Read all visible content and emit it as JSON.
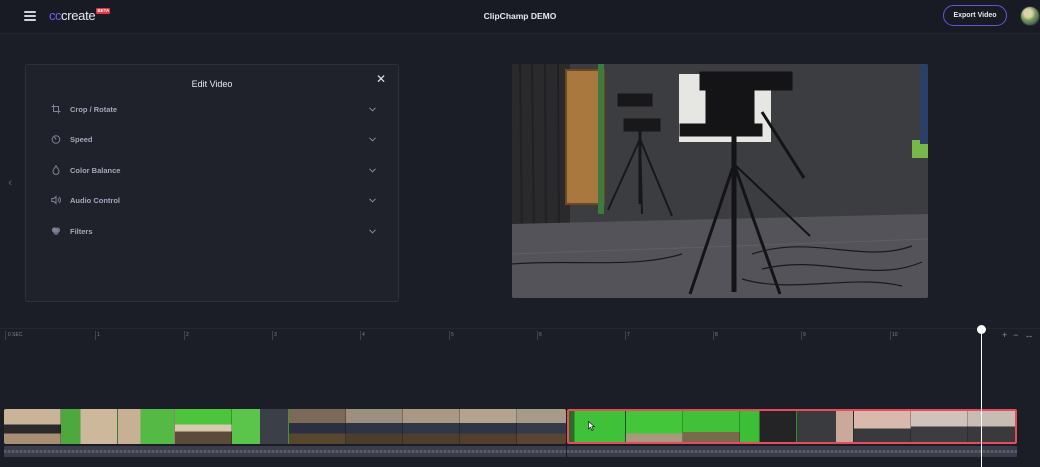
{
  "header": {
    "menu_icon": "hamburger-icon",
    "logo_prefix": "cc",
    "logo_word": "create",
    "logo_badge": "BETA",
    "title": "ClipChamp DEMO",
    "export_label": "Export Video"
  },
  "edit_panel": {
    "title": "Edit Video",
    "close_icon": "close-icon",
    "items": [
      {
        "label": "Crop / Rotate",
        "icon": "crop-icon"
      },
      {
        "label": "Speed",
        "icon": "speed-icon"
      },
      {
        "label": "Color Balance",
        "icon": "droplet-icon"
      },
      {
        "label": "Audio Control",
        "icon": "volume-icon"
      },
      {
        "label": "Filters",
        "icon": "filters-icon"
      }
    ]
  },
  "timeline": {
    "ticks": [
      "0 SEC",
      "1",
      "2",
      "3",
      "4",
      "5",
      "6",
      "7",
      "8",
      "9",
      "10"
    ],
    "zoom_in": "+",
    "zoom_out": "−",
    "expand": "↔"
  },
  "colors": {
    "accent": "#5e58d6",
    "selected_clip": "#e84b5a",
    "background": "#1b1d27"
  }
}
